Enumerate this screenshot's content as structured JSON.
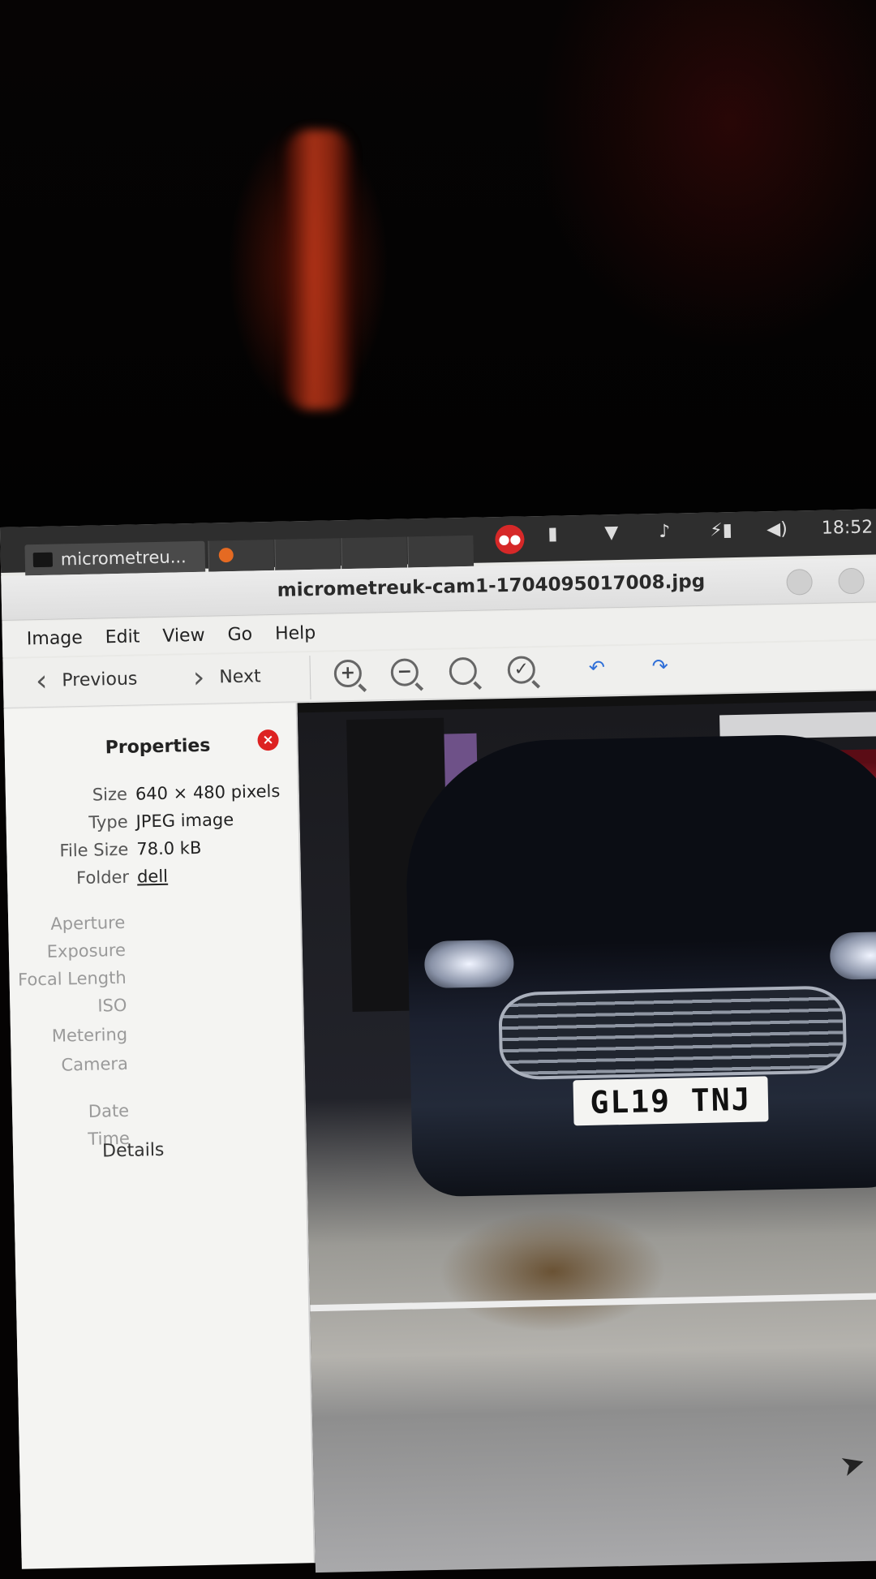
{
  "taskbar": {
    "task_label": "micrometreu...",
    "clock": "18:52"
  },
  "window": {
    "title": "micrometreuk-cam1-1704095017008.jpg"
  },
  "menu": [
    "Image",
    "Edit",
    "View",
    "Go",
    "Help"
  ],
  "toolbar": {
    "previous_label": "Previous",
    "next_label": "Next"
  },
  "properties": {
    "title": "Properties",
    "rows": [
      {
        "label": "Size",
        "value": "640 × 480 pixels"
      },
      {
        "label": "Type",
        "value": "JPEG image"
      },
      {
        "label": "File Size",
        "value": "78.0 kB"
      },
      {
        "label": "Folder",
        "value": "dell"
      }
    ],
    "exif_labels": [
      "Aperture",
      "Exposure",
      "Focal Length",
      "ISO",
      "Metering",
      "Camera"
    ],
    "date_labels": [
      "Date",
      "Time"
    ],
    "details_label": "Details"
  },
  "image": {
    "plate_text": "GL19 TNJ"
  }
}
